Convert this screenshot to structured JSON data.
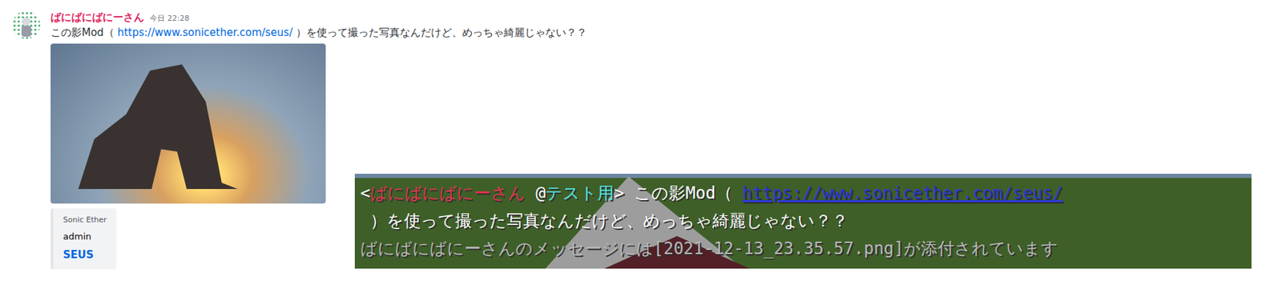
{
  "discord_message": {
    "author": "ばにばにばにーさん",
    "time": "今日 22:28",
    "text_before": "この影Mod（ ",
    "link": "https://www.sonicether.com/seus/",
    "text_after": " ）を使って撮った写真なんだけど、めっちゃ綺麗じゃない？？",
    "embed": {
      "provider": "Sonic Ether",
      "author": "admin",
      "title": "SEUS"
    }
  },
  "game_chat": {
    "lines": [
      {
        "segments": [
          {
            "text": "<",
            "kind": "text",
            "color": "#ffffff"
          },
          {
            "text": "ばにばにばにーさん",
            "kind": "text",
            "color": "#e8324f"
          },
          {
            "text": " @",
            "kind": "text",
            "color": "#ffffff"
          },
          {
            "text": "テスト用",
            "kind": "text",
            "color": "#55e6e6"
          },
          {
            "text": "> この影Mod（ ",
            "kind": "text",
            "color": "#ffffff"
          },
          {
            "text": "https://www.sonicether.com/seus/",
            "kind": "link",
            "color": "#2b3bd6"
          }
        ]
      },
      {
        "segments": [
          {
            "text": " ）を使って撮った写真なんだけど、めっちゃ綺麗じゃない？？",
            "kind": "text",
            "color": "#ffffff"
          }
        ]
      },
      {
        "segments": [
          {
            "text": "ばにばにばにーさんのメッセージには[2021-12-13_23.35.57.png]が添付されています",
            "kind": "text",
            "color": "#b8b8b8"
          }
        ]
      }
    ]
  }
}
